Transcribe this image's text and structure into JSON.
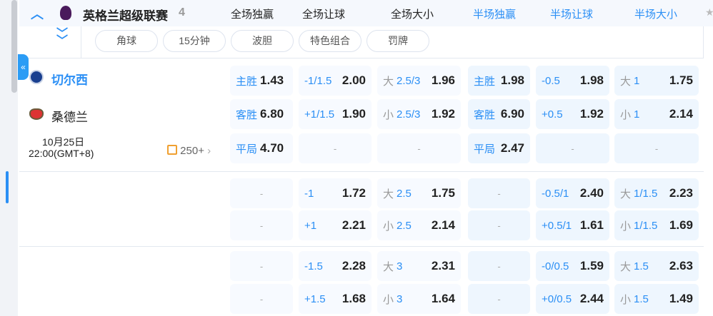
{
  "league": {
    "name": "英格兰超级联赛",
    "count": "4"
  },
  "columns": [
    {
      "label": "全场独赢",
      "color": "#222222"
    },
    {
      "label": "全场让球",
      "color": "#222222"
    },
    {
      "label": "全场大小",
      "color": "#222222"
    },
    {
      "label": "半场独赢",
      "color": "#2b8ff5"
    },
    {
      "label": "半场让球",
      "color": "#2b8ff5"
    },
    {
      "label": "半场大小",
      "color": "#2b8ff5"
    }
  ],
  "filters": [
    "角球",
    "15分钟",
    "波胆",
    "特色组合",
    "罚牌"
  ],
  "match": {
    "home": "切尔西",
    "away": "桑德兰",
    "date": "10月25日",
    "time": "22:00(GMT+8)",
    "more": "250+"
  },
  "colors": {
    "accent": "#2b8ff5",
    "fulltime_cell": "#f7faff",
    "halftime_cell": "#eef6fe"
  },
  "blocks": [
    [
      [
        {
          "lab": "主胜",
          "odds": "1.43"
        },
        {
          "line": "-1/1.5",
          "odds": "2.00"
        },
        {
          "pre": "大",
          "line": "2.5/3",
          "odds": "1.96"
        },
        {
          "lab": "主胜",
          "odds": "1.98"
        },
        {
          "line": "-0.5",
          "odds": "1.98"
        },
        {
          "pre": "大",
          "line": "1",
          "odds": "1.75"
        }
      ],
      [
        {
          "lab": "客胜",
          "odds": "6.80"
        },
        {
          "line": "+1/1.5",
          "odds": "1.90"
        },
        {
          "pre": "小",
          "line": "2.5/3",
          "odds": "1.92"
        },
        {
          "lab": "客胜",
          "odds": "6.90"
        },
        {
          "line": "+0.5",
          "odds": "1.92"
        },
        {
          "pre": "小",
          "line": "1",
          "odds": "2.14"
        }
      ],
      [
        {
          "lab": "平局",
          "odds": "4.70"
        },
        {
          "dash": "-"
        },
        {
          "dash": "-"
        },
        {
          "lab": "平局",
          "odds": "2.47"
        },
        {
          "dash": "-"
        },
        {
          "dash": "-"
        }
      ]
    ],
    [
      [
        {
          "dash": "-"
        },
        {
          "line": "-1",
          "odds": "1.72"
        },
        {
          "pre": "大",
          "line": "2.5",
          "odds": "1.75"
        },
        {
          "dash": "-"
        },
        {
          "line": "-0.5/1",
          "odds": "2.40"
        },
        {
          "pre": "大",
          "line": "1/1.5",
          "odds": "2.23"
        }
      ],
      [
        {
          "dash": "-"
        },
        {
          "line": "+1",
          "odds": "2.21"
        },
        {
          "pre": "小",
          "line": "2.5",
          "odds": "2.14"
        },
        {
          "dash": "-"
        },
        {
          "line": "+0.5/1",
          "odds": "1.61"
        },
        {
          "pre": "小",
          "line": "1/1.5",
          "odds": "1.69"
        }
      ]
    ],
    [
      [
        {
          "dash": "-"
        },
        {
          "line": "-1.5",
          "odds": "2.28"
        },
        {
          "pre": "大",
          "line": "3",
          "odds": "2.31"
        },
        {
          "dash": "-"
        },
        {
          "line": "-0/0.5",
          "odds": "1.59"
        },
        {
          "pre": "大",
          "line": "1.5",
          "odds": "2.63"
        }
      ],
      [
        {
          "dash": "-"
        },
        {
          "line": "+1.5",
          "odds": "1.68"
        },
        {
          "pre": "小",
          "line": "3",
          "odds": "1.64"
        },
        {
          "dash": "-"
        },
        {
          "line": "+0/0.5",
          "odds": "2.44"
        },
        {
          "pre": "小",
          "line": "1.5",
          "odds": "1.49"
        }
      ]
    ]
  ]
}
